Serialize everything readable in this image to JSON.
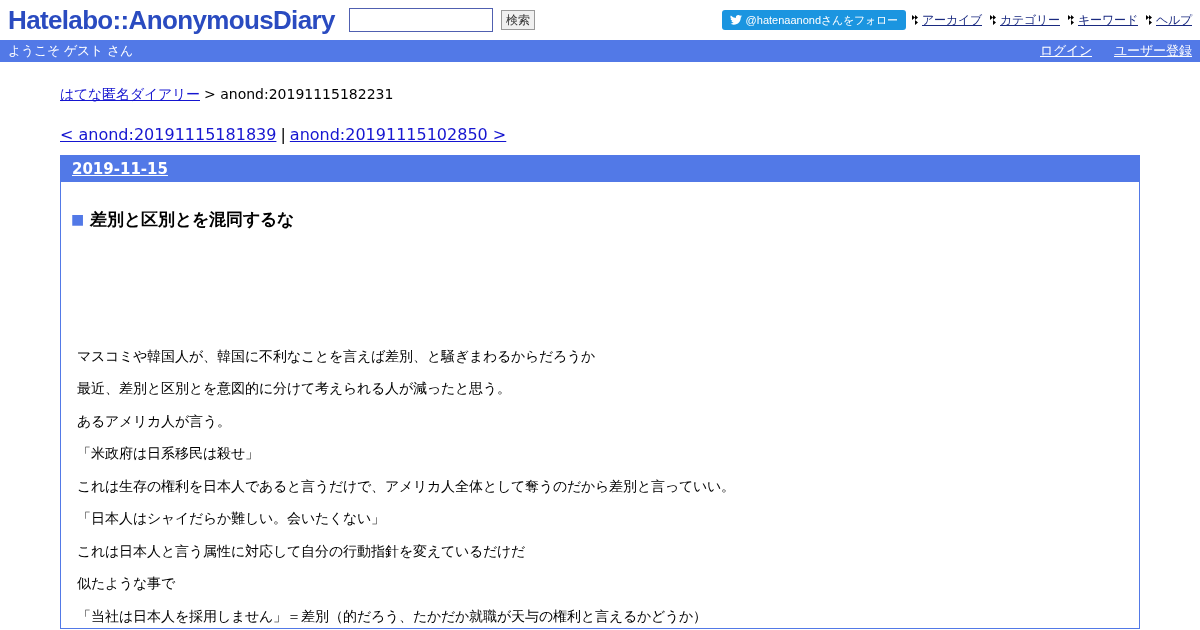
{
  "header": {
    "logo": "Hatelabo::AnonymousDiary",
    "search_button": "検索",
    "twitter_follow": "@hatenaanondさんをフォロー",
    "nav_links": [
      "アーカイブ",
      "カテゴリー",
      "キーワード",
      "ヘルプ"
    ]
  },
  "user_bar": {
    "welcome": "ようこそ ゲスト さん",
    "links": [
      "ログイン",
      "ユーザー登録"
    ]
  },
  "breadcrumb": {
    "link": "はてな匿名ダイアリー",
    "current": "> anond:20191115182231"
  },
  "pager": {
    "prev": "< anond:20191115181839",
    "separator": "|",
    "next": "anond:20191115102850 >"
  },
  "entry": {
    "date": "2019-11-15",
    "title_mark": "■",
    "title": "差別と区別とを混同するな",
    "paragraphs": [
      "マスコミや韓国人が、韓国に不利なことを言えば差別、と騒ぎまわるからだろうか",
      "最近、差別と区別とを意図的に分けて考えられる人が減ったと思う。",
      "あるアメリカ人が言う。",
      "「米政府は日系移民は殺せ」",
      "これは生存の権利を日本人であると言うだけで、アメリカ人全体として奪うのだから差別と言っていい。",
      "「日本人はシャイだらか難しい。会いたくない」",
      "これは日本人と言う属性に対応して自分の行動指針を変えているだけだ",
      "似たような事で",
      "「当社は日本人を採用しません」＝差別（的だろう、たかだか就職が天与の権利と言えるかどうか）"
    ]
  }
}
